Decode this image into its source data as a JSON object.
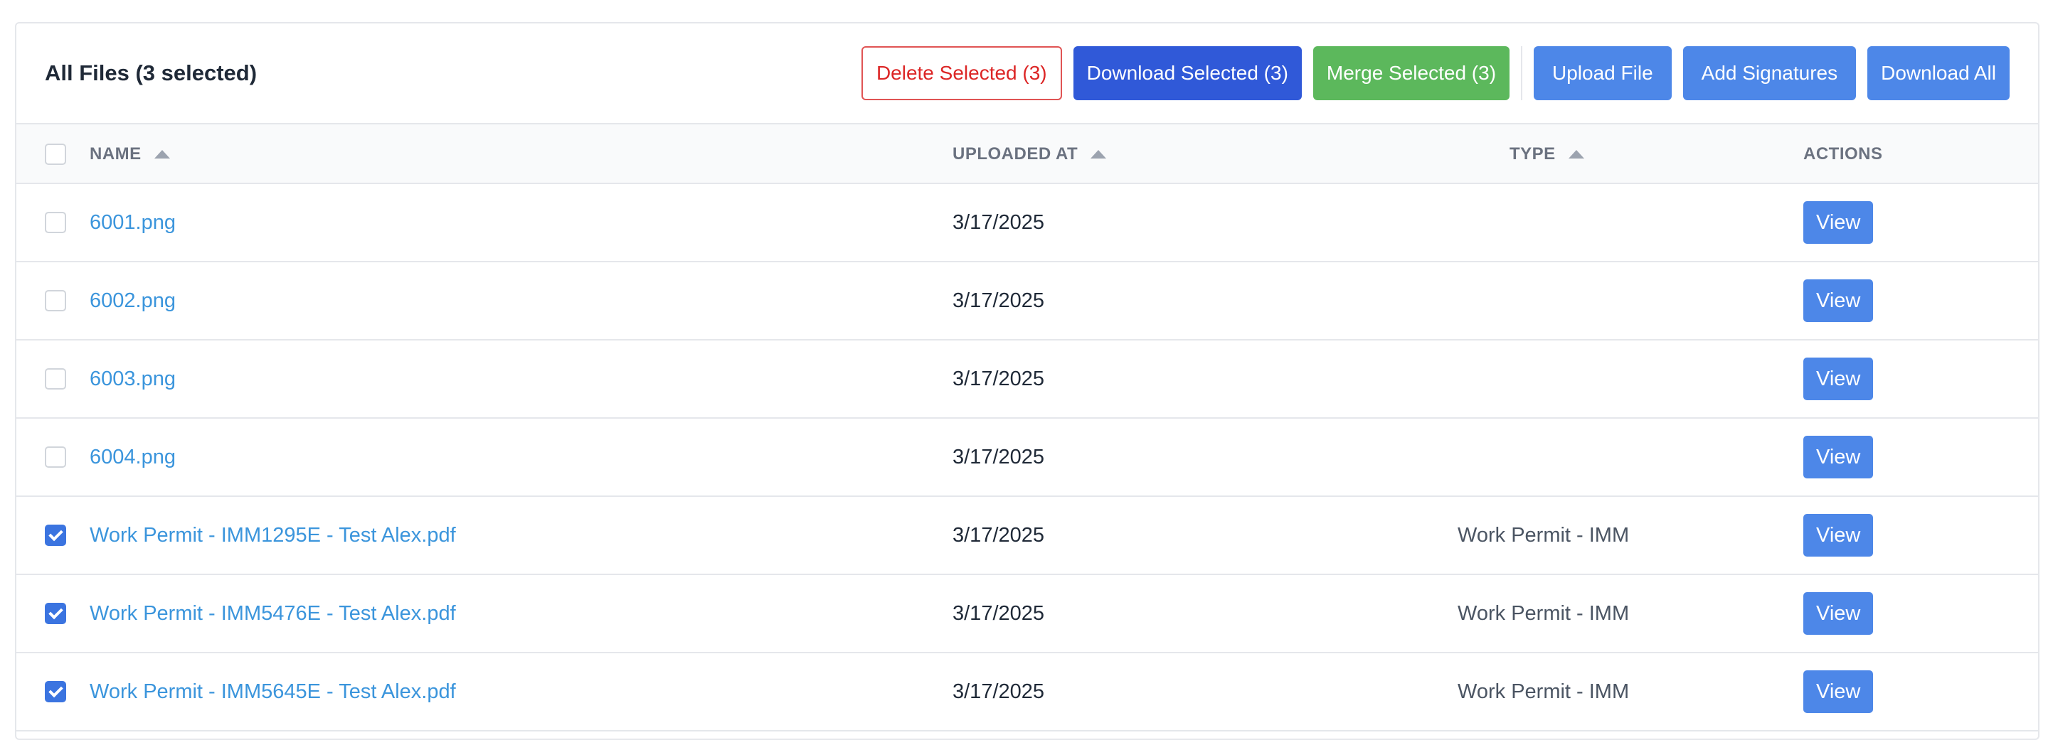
{
  "header": {
    "title": "All Files (3 selected)",
    "buttons": {
      "delete_selected": "Delete Selected (3)",
      "download_selected": "Download Selected (3)",
      "merge_selected": "Merge Selected (3)",
      "upload_file": "Upload File",
      "add_signatures": "Add Signatures",
      "download_all": "Download All"
    }
  },
  "table": {
    "columns": {
      "name": "NAME",
      "uploaded_at": "UPLOADED AT",
      "type": "TYPE",
      "actions": "ACTIONS"
    },
    "view_label": "View",
    "rows": [
      {
        "checked": false,
        "name": "6001.png",
        "uploaded_at": "3/17/2025",
        "type": ""
      },
      {
        "checked": false,
        "name": "6002.png",
        "uploaded_at": "3/17/2025",
        "type": ""
      },
      {
        "checked": false,
        "name": "6003.png",
        "uploaded_at": "3/17/2025",
        "type": ""
      },
      {
        "checked": false,
        "name": "6004.png",
        "uploaded_at": "3/17/2025",
        "type": ""
      },
      {
        "checked": true,
        "name": "Work Permit - IMM1295E - Test Alex.pdf",
        "uploaded_at": "3/17/2025",
        "type": "Work Permit - IMM"
      },
      {
        "checked": true,
        "name": "Work Permit - IMM5476E - Test Alex.pdf",
        "uploaded_at": "3/17/2025",
        "type": "Work Permit - IMM"
      },
      {
        "checked": true,
        "name": "Work Permit - IMM5645E - Test Alex.pdf",
        "uploaded_at": "3/17/2025",
        "type": "Work Permit - IMM"
      }
    ]
  },
  "colors": {
    "accent_blue": "#4d87e8",
    "download_selected_blue": "#3059d8",
    "merge_green": "#5cb85c",
    "delete_red": "#dc2626",
    "link_blue": "#3b95dc",
    "checkbox_checked": "#3b74e0"
  }
}
